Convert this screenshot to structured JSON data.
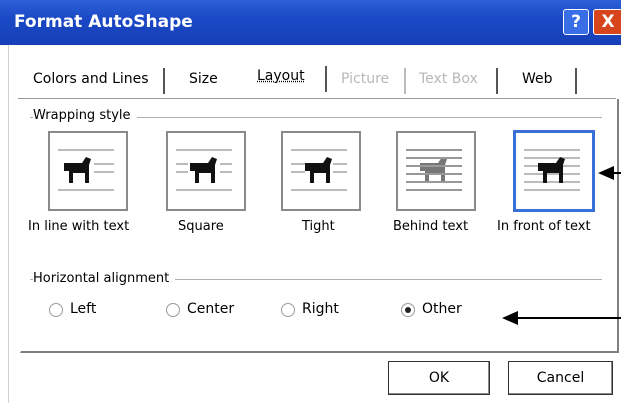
{
  "window": {
    "title": "Format AutoShape",
    "help_label": "?",
    "close_label": "X"
  },
  "tabs": [
    {
      "label": "Colors and Lines",
      "state": "normal"
    },
    {
      "label": "Size",
      "state": "normal"
    },
    {
      "label": "Layout",
      "state": "selected"
    },
    {
      "label": "Picture",
      "state": "disabled"
    },
    {
      "label": "Text Box",
      "state": "disabled"
    },
    {
      "label": "Web",
      "state": "normal"
    }
  ],
  "wrapping": {
    "label": "Wrapping style",
    "options": [
      {
        "label": "In line with text",
        "icon": "inline-dog-icon"
      },
      {
        "label": "Square",
        "icon": "square-dog-icon"
      },
      {
        "label": "Tight",
        "icon": "tight-dog-icon"
      },
      {
        "label": "Behind text",
        "icon": "behind-dog-icon"
      },
      {
        "label": "In front of text",
        "icon": "front-dog-icon",
        "selected": true
      }
    ]
  },
  "alignment": {
    "label": "Horizontal alignment",
    "options": [
      {
        "label": "Left",
        "checked": false
      },
      {
        "label": "Center",
        "checked": false
      },
      {
        "label": "Right",
        "checked": false
      },
      {
        "label": "Other",
        "checked": true
      }
    ]
  },
  "buttons": {
    "ok": "OK",
    "cancel": "Cancel"
  },
  "colors": {
    "titlebar": "#1a47c4",
    "selected_border": "#3a6fd8",
    "close": "#d6451c"
  }
}
